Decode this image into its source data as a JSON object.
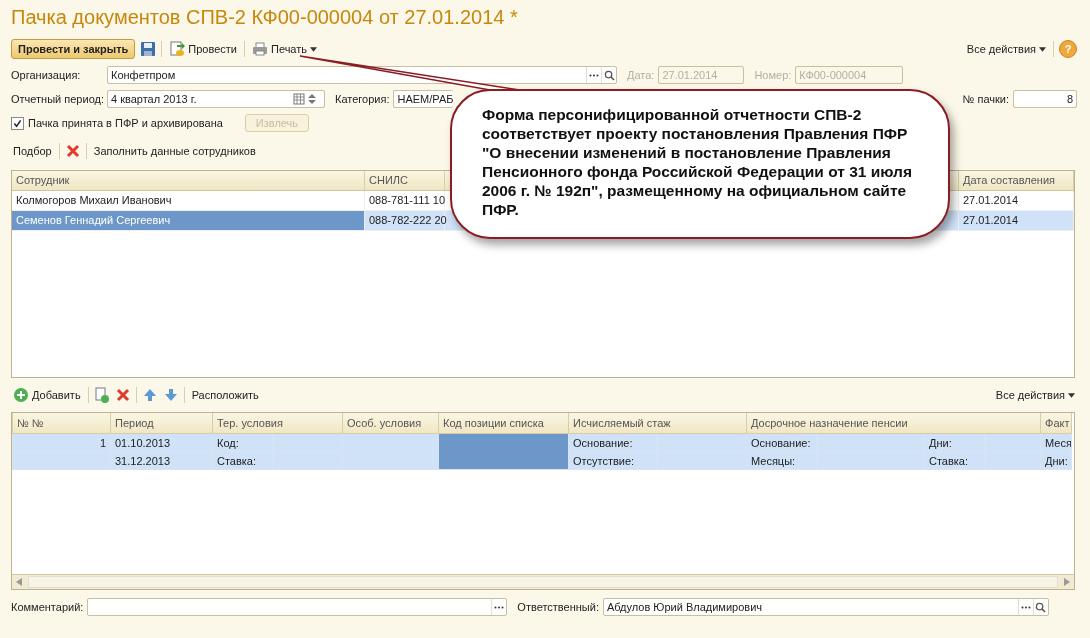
{
  "window": {
    "title": "Пачка документов СПВ-2 КФ00-000004 от 27.01.2014 *"
  },
  "toolbar": {
    "post_close": "Провести и закрыть",
    "post": "Провести",
    "print": "Печать",
    "all_actions": "Все действия",
    "help": "?"
  },
  "form": {
    "organization": {
      "label": "Организация:",
      "value": "Конфетпром"
    },
    "date": {
      "label": "Дата:",
      "value": "27.01.2014",
      "disabled": true
    },
    "number": {
      "label": "Номер:",
      "value": "КФ00-000004",
      "disabled": true
    },
    "period": {
      "label": "Отчетный период:",
      "value": "4 квартал 2013 г."
    },
    "category": {
      "label": "Категория:",
      "value": "НАЕМ/РАБ"
    },
    "pack_number": {
      "label": "№ пачки:",
      "value": "8"
    },
    "accepted": {
      "label": "Пачка принята в ПФР и архивирована",
      "checked": true
    },
    "extract": {
      "label": "Извлечь",
      "disabled": true
    }
  },
  "employees_toolbar": {
    "pick": "Подбор",
    "fill": "Заполнить данные сотрудников"
  },
  "employees": {
    "columns": [
      "Сотрудник",
      "СНИЛС",
      "",
      "Дата составления"
    ],
    "rows": [
      {
        "name": "Колмогоров Михаил Иванович",
        "snils": "088-781-111 10",
        "date": "27.01.2014",
        "selected": false
      },
      {
        "name": "Семенов Геннадий Сергеевич",
        "snils": "088-782-222 20",
        "date": "27.01.2014",
        "selected": true
      }
    ]
  },
  "periods_toolbar": {
    "add": "Добавить",
    "arrange": "Расположить",
    "all_actions": "Все действия"
  },
  "periods": {
    "columns": [
      "№ №",
      "Период",
      "Тер. условия",
      "Особ. условия",
      "Код позиции списка",
      "Исчисляемый стаж",
      "Досрочное назначение пенсии",
      "Факт"
    ],
    "rows": [
      {
        "number": "1",
        "selected": true,
        "lines": [
          {
            "period": "01.10.2013",
            "ter": "Код:",
            "stazh": "Основание:",
            "early_1": "Основание:",
            "early_2": "Дни:",
            "fact": "Меся"
          },
          {
            "period": "31.12.2013",
            "ter": "Ставка:",
            "stazh": "Отсутствие:",
            "early_1": "Месяцы:",
            "early_2": "Ставка:",
            "fact": "Дни:"
          }
        ]
      }
    ]
  },
  "footer": {
    "comment": {
      "label": "Комментарий:"
    },
    "responsible": {
      "label": "Ответственный:",
      "value": "Абдулов Юрий Владимирович"
    }
  },
  "callout": {
    "text": "Форма персонифицированной отчетности СПВ-2 соответствует проекту постановления Правления ПФР \"О внесении изменений в постановление Правления Пенсионного фонда Российской Федерации от 31 июля 2006 г. № 192п\", размещенному на официальном сайте ПФР."
  }
}
